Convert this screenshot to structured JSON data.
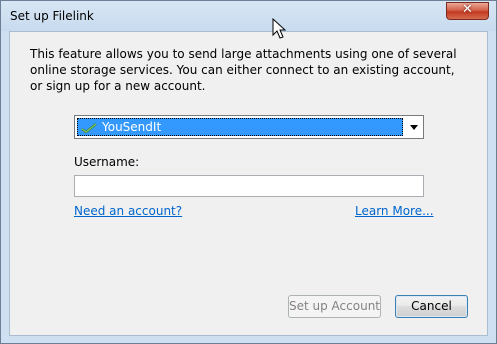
{
  "window": {
    "title": "Set up Filelink",
    "close_label": "✕"
  },
  "description": "This feature allows you to send large attachments using one of several online storage services. You can either connect to an existing account, or sign up for a new account.",
  "provider": {
    "selected": "YouSendIt",
    "icon": "yousendit-check-icon"
  },
  "username": {
    "label": "Username:",
    "value": ""
  },
  "links": {
    "need_account": "Need an account?",
    "learn_more": "Learn More..."
  },
  "buttons": {
    "setup_account": "Set up Account",
    "cancel": "Cancel"
  }
}
